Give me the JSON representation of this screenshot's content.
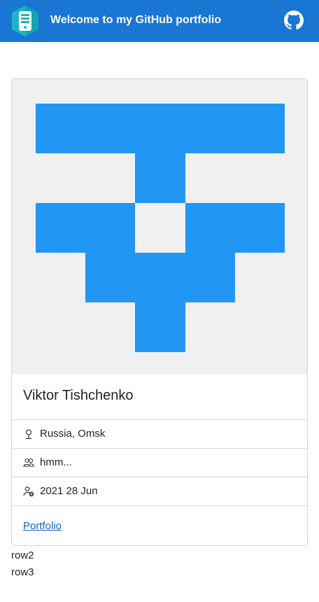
{
  "header": {
    "title": "Welcome to my GitHub portfolio",
    "logo_icon": "mobile-app-hexagon-icon",
    "github_icon": "github-icon",
    "brand_color": "#1976d2"
  },
  "profile": {
    "avatar_icon": "identicon-avatar",
    "avatar_color": "#2196f3",
    "avatar_background": "#f0f0f0",
    "name": "Viktor Tishchenko",
    "details": [
      {
        "icon": "location-pin-icon",
        "text": "Russia, Omsk"
      },
      {
        "icon": "people-icon",
        "text": "hmm..."
      },
      {
        "icon": "user-add-icon",
        "text": "2021 28 Jun"
      }
    ],
    "link_label": "Portfolio"
  },
  "rows": [
    "row2",
    "row3"
  ]
}
